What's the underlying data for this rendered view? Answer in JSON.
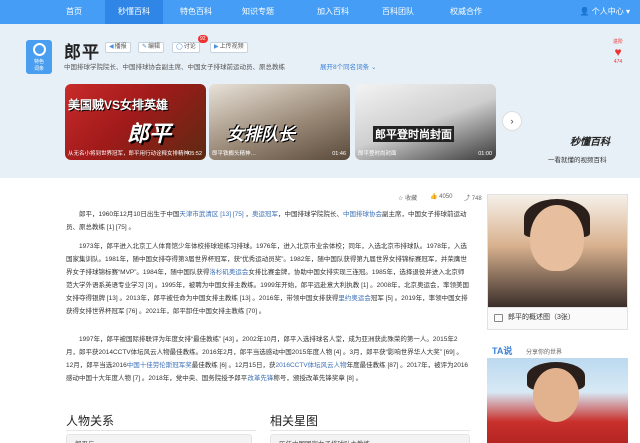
{
  "nav": {
    "items": [
      "首页",
      "秒懂百科",
      "特色百科",
      "知识专题",
      "加入百科",
      "百科团队",
      "权威合作"
    ],
    "user": "个人中心"
  },
  "header": {
    "badge_lines": [
      "特色",
      "词条"
    ],
    "title": "郎平",
    "tools": [
      "播报",
      "编辑",
      "讨论",
      "上传视频"
    ],
    "discussion_count": "92",
    "subtitle": "中国排球学院院长、中国排球协会副主席、中国女子排球前运动员、原总教练",
    "expand_link": "展开8个同名词条",
    "vote_label": "进阶",
    "vote_count": "474"
  },
  "carousel": {
    "cards": [
      {
        "overlay": "美国贼VS女排英雄",
        "big": "郎平",
        "caption": "从无名小将到世界冠军，郎平用行动诠释女排精神",
        "duration": "05:52"
      },
      {
        "overlay": "女排队长",
        "big": "",
        "caption": "郎平铁榔头精神…",
        "duration": "01:46"
      },
      {
        "overlay": "郎平登时尚封面",
        "big": "",
        "caption": "郎平登时尚封面",
        "duration": "01:00"
      }
    ],
    "next_icon": "chevron-right-icon",
    "brand": "秒懂百科",
    "slogan": "一看就懂的视频百科"
  },
  "actions": {
    "favorite": "收藏",
    "likes": "4050",
    "shares": "748"
  },
  "article": {
    "p1": [
      {
        "t": "郎平，1960年12月10日出生于中国"
      },
      {
        "t": "天津市武清区",
        "link": true
      },
      {
        "t": " [13] [75] ",
        "link": true
      },
      {
        "t": "，"
      },
      {
        "t": "奥运冠军",
        "link": true
      },
      {
        "t": "，中国排球学院院长、"
      },
      {
        "t": "中国排球协会",
        "link": true
      },
      {
        "t": "副主席，中国女子排球前运动员、原总教练 [1] [75] 。"
      }
    ],
    "p2": [
      {
        "t": "1973年，郎平进入北京工人体育馆少年体校排球班练习排球。1976年，进入北京市业余体校；同年，入选北京市排球队。1978年，入选国家集训队。1981年，随中国女排夺得第3届世界杯冠军，获“优秀运动员奖”。1982年，随中国队获得第九届世界女排锦标赛冠军，并荣膺世界女子排球锦标赛“MVP”。1984年，随中国队获得"
      },
      {
        "t": "洛杉矶奥运会",
        "link": true
      },
      {
        "t": "女排比赛金牌，协助中国女排实现三连冠。1985年，选择退役并进入北京师范大学外语系英语专业学习 [3] 。1995年，被聘为中国女排主教练。1999年开始，郎平远赴意大利执教 [1] 。2008年，北京奥运会，率领美国女排夺得银牌 [13] 。2013年，郎平被任命为中国女排主教练 [13] 。2016年，带领中国女排获得"
      },
      {
        "t": "里约奥运会",
        "link": true
      },
      {
        "t": "冠军 [5] 。2019年，率领中国女排获得女排世界杯冠军 [76] 。2021年，郎平卸任中国女排主教练 [70] 。"
      }
    ],
    "p3": [
      {
        "t": "1997年，郎平被国际排联评为年度女排“最佳教练” [43] 。2002年10月，郎平入选排球名人堂，成为亚洲获此殊荣的第一人。2015年2月，郎平获2014CCTV体坛风云人物最佳教练。2016年2月，郎平当选感动中国2015年度人物 [4] 。3月，郎平获“影响世界华人大奖” [69] 。12月，郎平当选2016"
      },
      {
        "t": "中国十佳劳伦斯冠军奖",
        "link": true
      },
      {
        "t": "最佳教练 [6] 。12月15日，获"
      },
      {
        "t": "2016CCTV体坛风云人物",
        "link": true
      },
      {
        "t": "年度最佳教练 [87] 。2017年，被评为2016感动中国十大年度人物 [7] 。2018年，党中央、国务院授予郎平"
      },
      {
        "t": "改革先锋",
        "link": true
      },
      {
        "t": "称号，颁授改革先锋奖章 [8] 。"
      }
    ]
  },
  "sections": {
    "relations_title": "人物关系",
    "relations_box": "郎平与…",
    "related_title": "相关星图",
    "related_box": "历任中国国家女子排球队主教练"
  },
  "sidebar": {
    "overview_caption": "郎平的概述图（3张）",
    "ta_brand": "TA说",
    "ta_sub": "分享你的世界"
  }
}
